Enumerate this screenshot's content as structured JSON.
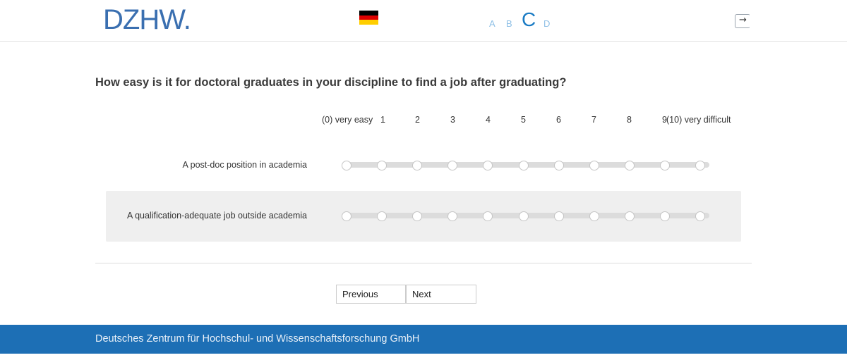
{
  "header": {
    "logo_text": "DZHW",
    "logo_dot": ".",
    "language_flag": "germany-flag",
    "font_size_options": [
      "A",
      "B",
      "C",
      "D"
    ],
    "logout_icon": "logout-icon",
    "colors": {
      "brand_blue": "#3a6fb0",
      "active_size": "#1a7bc4",
      "inactive_size": "#8fc0e6"
    }
  },
  "question": {
    "text": "How easy is it for doctoral graduates in your discipline to find a job after graduating?"
  },
  "scale": {
    "labels": [
      "(0) very easy",
      "1",
      "2",
      "3",
      "4",
      "5",
      "6",
      "7",
      "8",
      "9",
      "(10) very difficult"
    ]
  },
  "items": [
    {
      "label": "A post-doc position in academia",
      "selected": null
    },
    {
      "label": "A qualification-adequate job outside academia",
      "selected": null
    }
  ],
  "nav": {
    "previous_label": "Previous",
    "next_label": "Next"
  },
  "footer": {
    "text": "Deutsches Zentrum für Hochschul- und Wissenschaftsforschung GmbH",
    "color": "#1d6fb5"
  }
}
